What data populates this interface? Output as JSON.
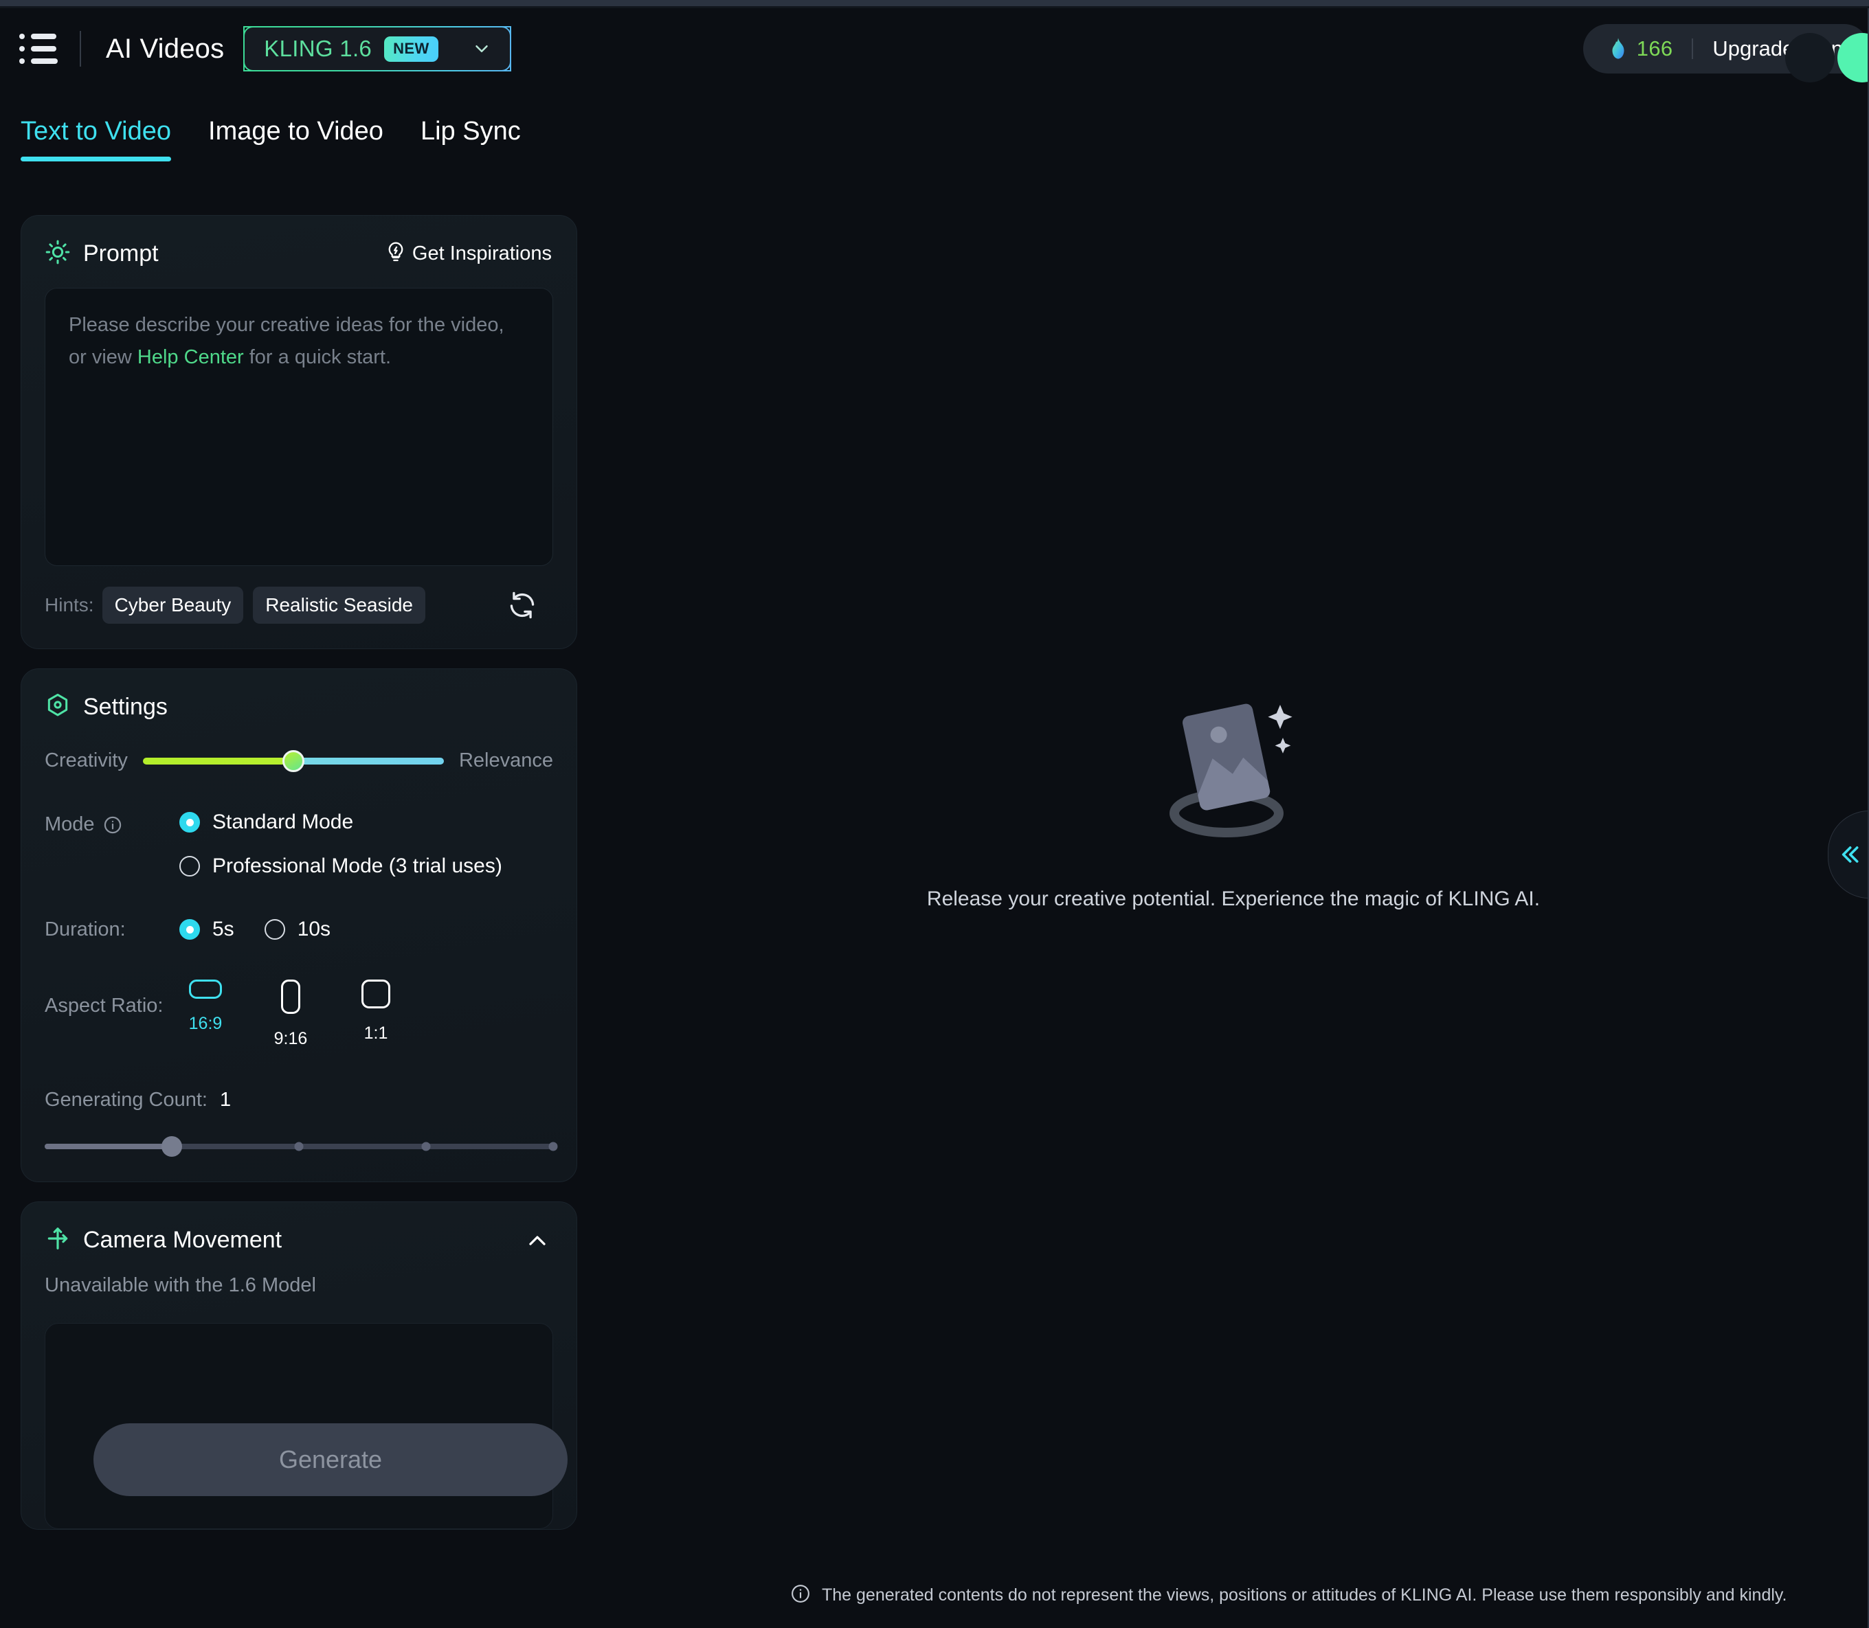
{
  "header": {
    "menu_icon": "hamburger-list-icon",
    "app_title": "AI Videos",
    "model": {
      "name": "KLING 1.6",
      "badge": "NEW",
      "caret_icon": "chevron-down-icon"
    },
    "credits": {
      "icon": "flame-icon",
      "value": "166"
    },
    "upgrade_label": "Upgrade Plan",
    "avatar": "user-avatar"
  },
  "tabs": [
    {
      "label": "Text to Video",
      "active": true
    },
    {
      "label": "Image to Video",
      "active": false
    },
    {
      "label": "Lip Sync",
      "active": false
    }
  ],
  "prompt": {
    "icon": "sun-idea-icon",
    "title": "Prompt",
    "inspirations_icon": "lightbulb-bolt-icon",
    "inspirations_label": "Get Inspirations",
    "placeholder_line1": "Please describe your creative ideas for the video,",
    "placeholder_line2_pre": "or view ",
    "placeholder_link": "Help Center",
    "placeholder_line2_post": " for a quick start.",
    "value": "",
    "hints_label": "Hints:",
    "hints": [
      "Cyber Beauty",
      "Realistic Seaside"
    ],
    "refresh_icon": "refresh-icon"
  },
  "settings": {
    "icon": "settings-hex-icon",
    "title": "Settings",
    "creativity": {
      "left_label": "Creativity",
      "right_label": "Relevance",
      "value_percent": 50
    },
    "mode": {
      "label": "Mode",
      "info_icon": "info-circle-icon",
      "options": [
        {
          "label": "Standard Mode",
          "selected": true
        },
        {
          "label": "Professional Mode (3 trial uses)",
          "selected": false
        }
      ]
    },
    "duration": {
      "label": "Duration:",
      "options": [
        {
          "label": "5s",
          "selected": true
        },
        {
          "label": "10s",
          "selected": false
        }
      ]
    },
    "aspect_ratio": {
      "label": "Aspect Ratio:",
      "options": [
        {
          "label": "16:9",
          "selected": true
        },
        {
          "label": "9:16",
          "selected": false
        },
        {
          "label": "1:1",
          "selected": false
        }
      ]
    },
    "generating_count": {
      "label": "Generating Count:",
      "value": "1",
      "slider_percent": 25
    }
  },
  "camera_movement": {
    "icon": "camera-movement-icon",
    "title": "Camera Movement",
    "collapse_icon": "chevron-up-icon",
    "unavailable_text": "Unavailable with the 1.6 Model"
  },
  "generate": {
    "label": "Generate",
    "enabled": false
  },
  "stage": {
    "art_icon": "empty-image-placeholder-icon",
    "empty_text": "Release your creative potential. Experience the magic of KLING AI."
  },
  "sidebar_toggle": {
    "icon": "double-chevron-left-icon"
  },
  "footer": {
    "icon": "info-circle-icon",
    "text": "The generated contents do not represent the views, positions or attitudes of KLING AI. Please use them responsibly and kindly."
  },
  "colors": {
    "accent_cyan": "#3fe0ef",
    "accent_green": "#5ddf9e",
    "credits_green": "#7ed957",
    "page_bg": "#0b0e13",
    "panel_bg": "#131a20"
  }
}
